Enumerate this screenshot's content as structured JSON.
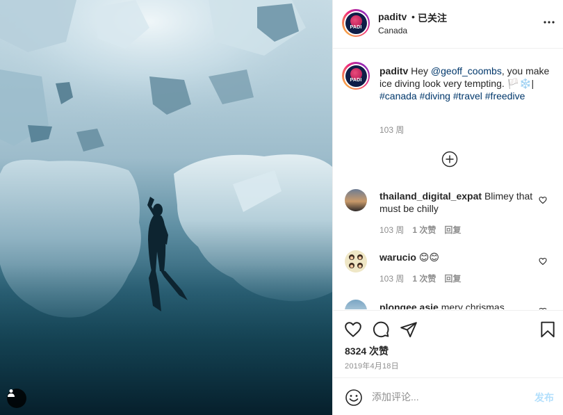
{
  "post": {
    "username": "paditv",
    "separator": "•",
    "follow_status": "已关注",
    "location": "Canada"
  },
  "caption": {
    "username": "paditv",
    "text_before": "Hey ",
    "mention": "@geoff_coombs",
    "text_after": ", you make ice diving look very tempting. 🏳️❄️| ",
    "hashtags": "#canada #diving #travel #freedive",
    "time": "103 周"
  },
  "comments": [
    {
      "username": "thailand_digital_expat",
      "text": "Blimey that must be chilly",
      "time": "103 周",
      "likes": "1 次赞",
      "reply": "回复"
    },
    {
      "username": "warucio",
      "text": "😊😊",
      "time": "103 周",
      "likes": "1 次赞",
      "reply": "回复"
    },
    {
      "username": "plongee.asie",
      "text": "mery chrismas",
      "time": "",
      "likes": "",
      "reply": ""
    }
  ],
  "engagement": {
    "likes_count": "8324 次赞",
    "date": "2019年4月18日"
  },
  "add_comment": {
    "placeholder": "添加评论...",
    "post_label": "发布"
  },
  "icons": {
    "more": "more-options-icon",
    "load_more": "plus-circle-icon",
    "like": "heart-icon",
    "comment": "comment-icon",
    "share": "paper-plane-icon",
    "save": "bookmark-icon",
    "emoji": "emoji-icon",
    "user_tag": "user-tag-icon"
  },
  "colors": {
    "link": "#00376b",
    "muted": "#8e8e8e",
    "post_button_disabled": "#b2dffc"
  }
}
